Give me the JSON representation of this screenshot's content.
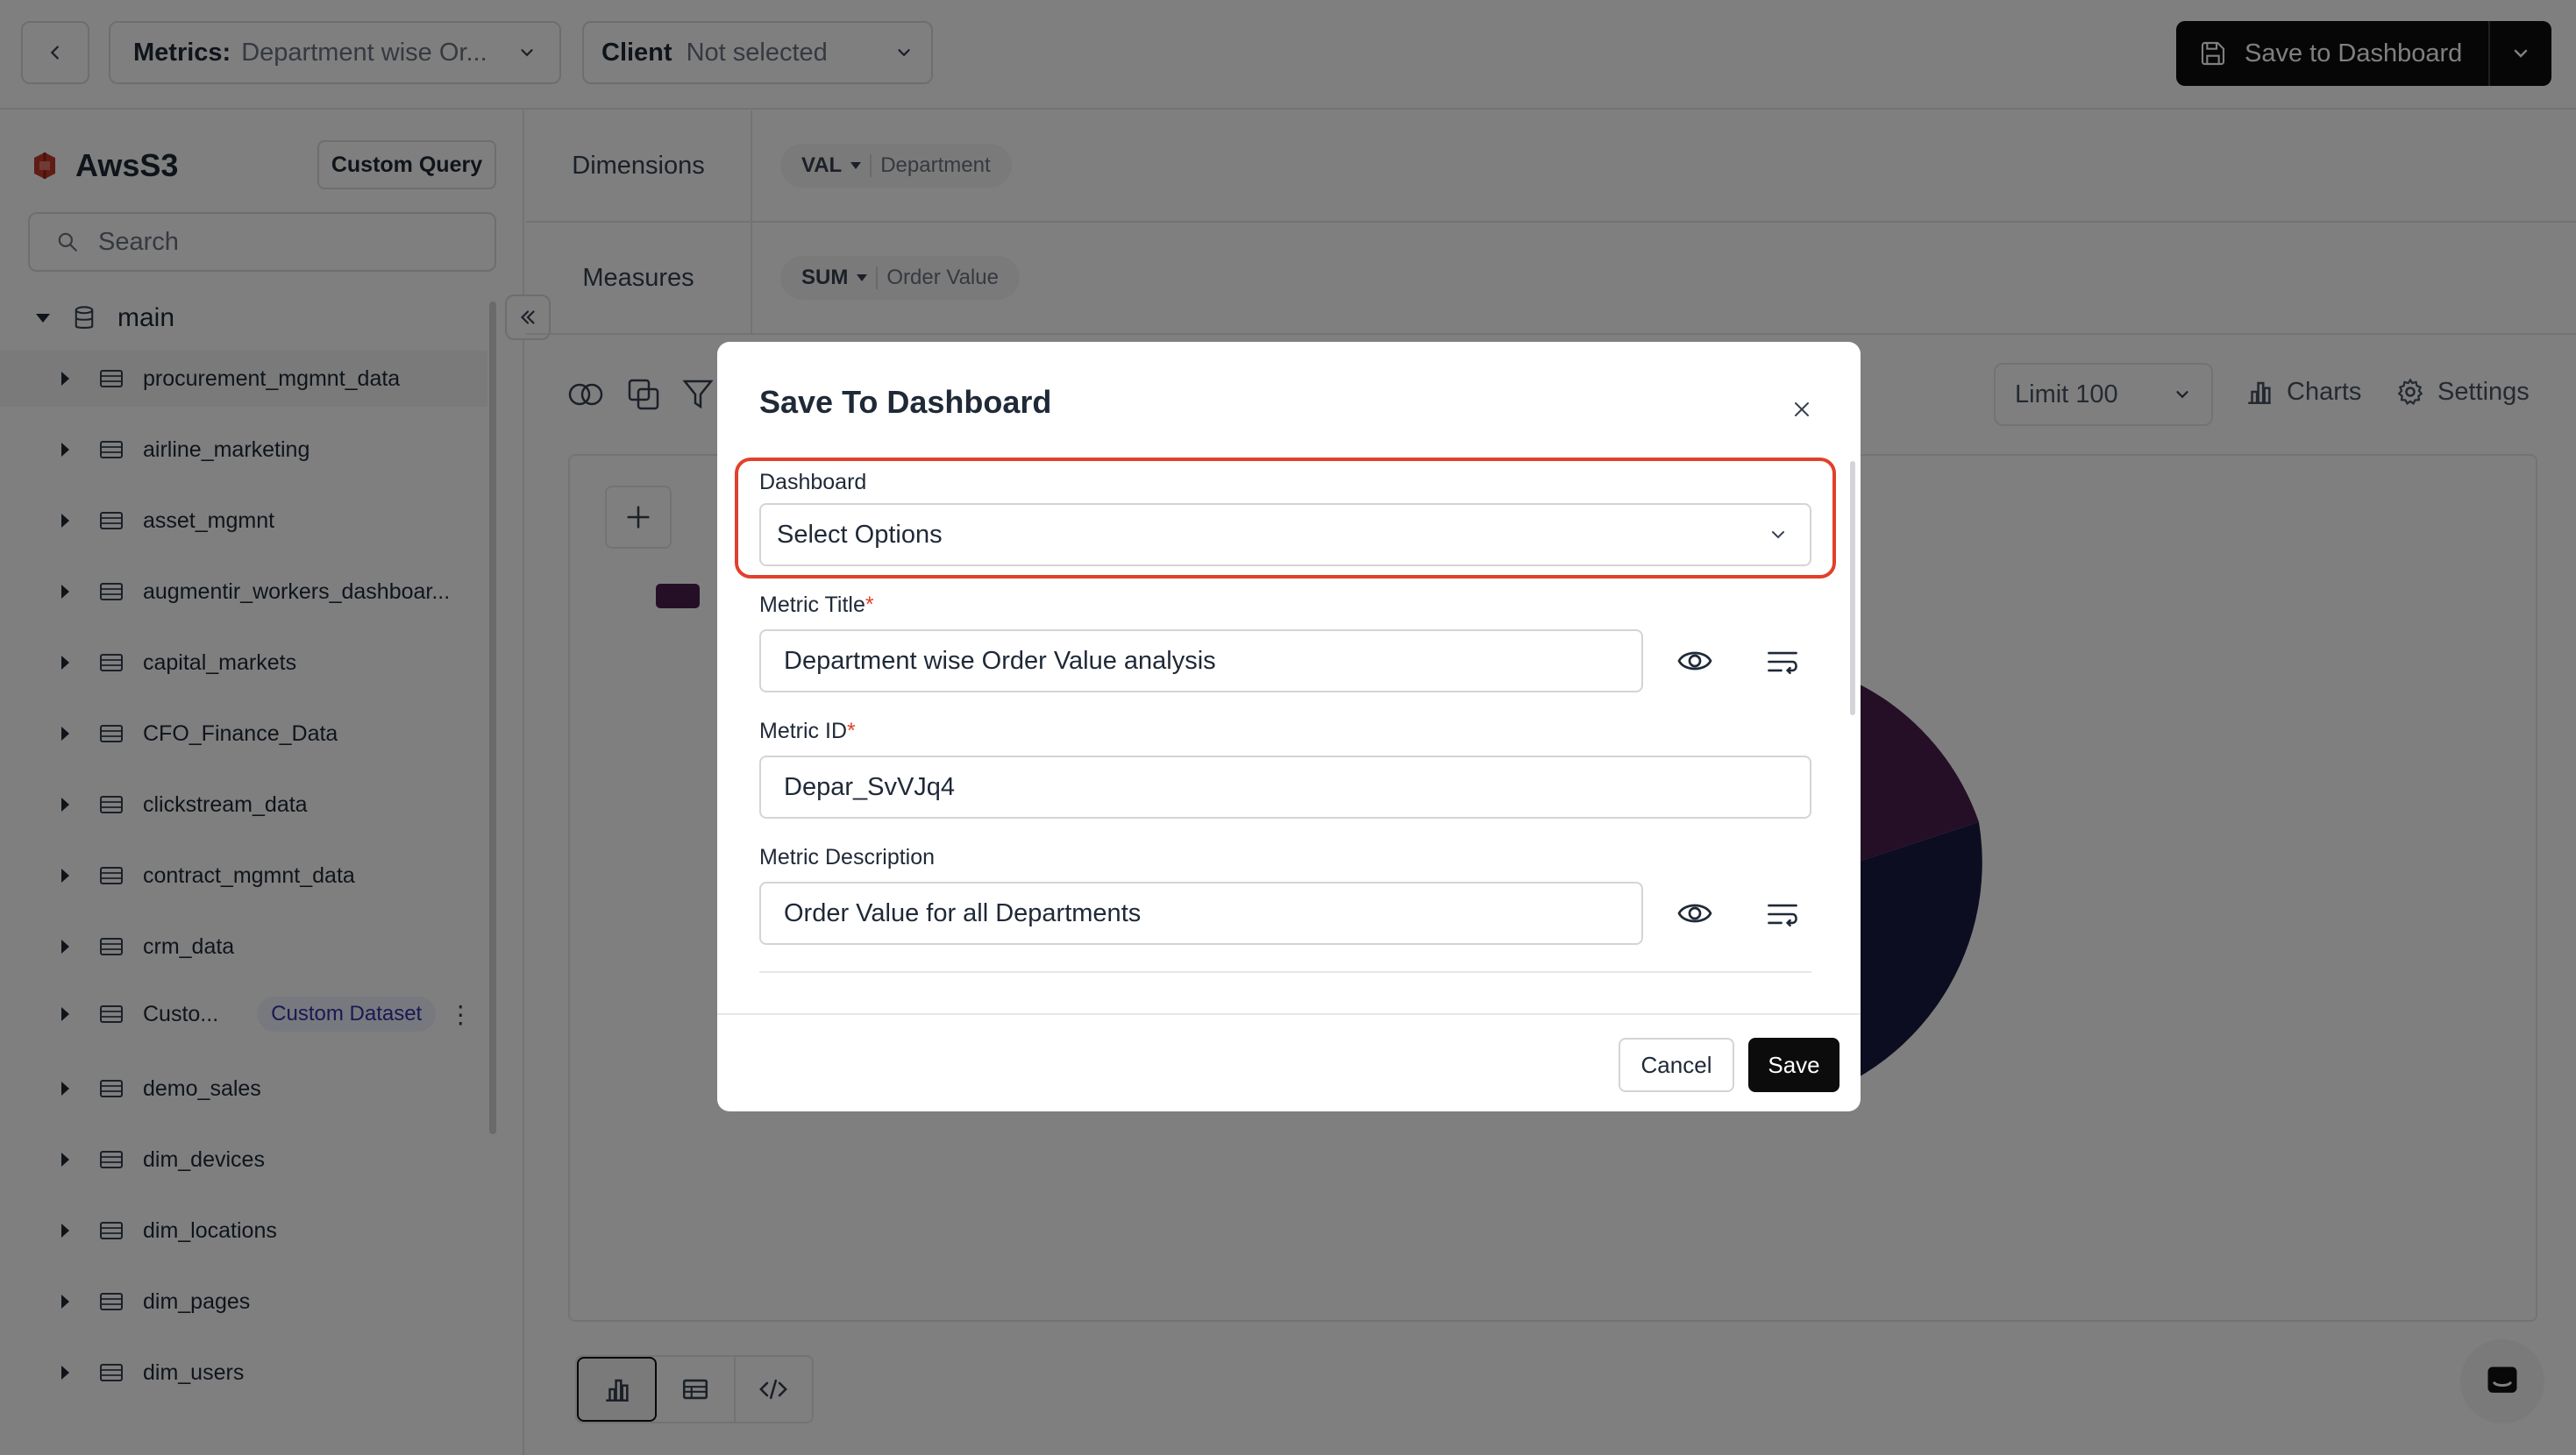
{
  "topbar": {
    "metrics_label": "Metrics:",
    "metrics_value": "Department wise Or...",
    "client_label": "Client",
    "client_value": "Not selected",
    "save_to_dashboard": "Save to Dashboard"
  },
  "sidebar": {
    "datasource": "AwsS3",
    "custom_query": "Custom Query",
    "search_placeholder": "Search",
    "schema": "main",
    "items": [
      {
        "label": "procurement_mgmnt_data"
      },
      {
        "label": "airline_marketing"
      },
      {
        "label": "asset_mgmnt"
      },
      {
        "label": "augmentir_workers_dashboar..."
      },
      {
        "label": "capital_markets"
      },
      {
        "label": "CFO_Finance_Data"
      },
      {
        "label": "clickstream_data"
      },
      {
        "label": "contract_mgmnt_data"
      },
      {
        "label": "crm_data"
      },
      {
        "label": "Custo...",
        "badge": "Custom Dataset"
      },
      {
        "label": "demo_sales"
      },
      {
        "label": "dim_devices"
      },
      {
        "label": "dim_locations"
      },
      {
        "label": "dim_pages"
      },
      {
        "label": "dim_users"
      }
    ]
  },
  "query": {
    "dimensions_label": "Dimensions",
    "dimension_agg": "VAL",
    "dimension_field": "Department",
    "measures_label": "Measures",
    "measure_agg": "SUM",
    "measure_field": "Order Value",
    "limit": "Limit 100",
    "charts": "Charts",
    "settings": "Settings"
  },
  "colors": {
    "pie_slice_1": "#4a1e4f",
    "pie_slice_2": "#1a1a44",
    "highlight": "#e1412b",
    "primary_button": "#0c0c0d"
  },
  "modal": {
    "title": "Save To Dashboard",
    "dashboard_label": "Dashboard",
    "dashboard_value": "Select Options",
    "metric_title_label": "Metric Title",
    "metric_title_value": "Department wise Order Value analysis",
    "metric_id_label": "Metric ID",
    "metric_id_value": "Depar_SvVJq4",
    "metric_desc_label": "Metric Description",
    "metric_desc_value": "Order Value for all Departments",
    "required_mark": "*",
    "cancel": "Cancel",
    "save": "Save"
  }
}
